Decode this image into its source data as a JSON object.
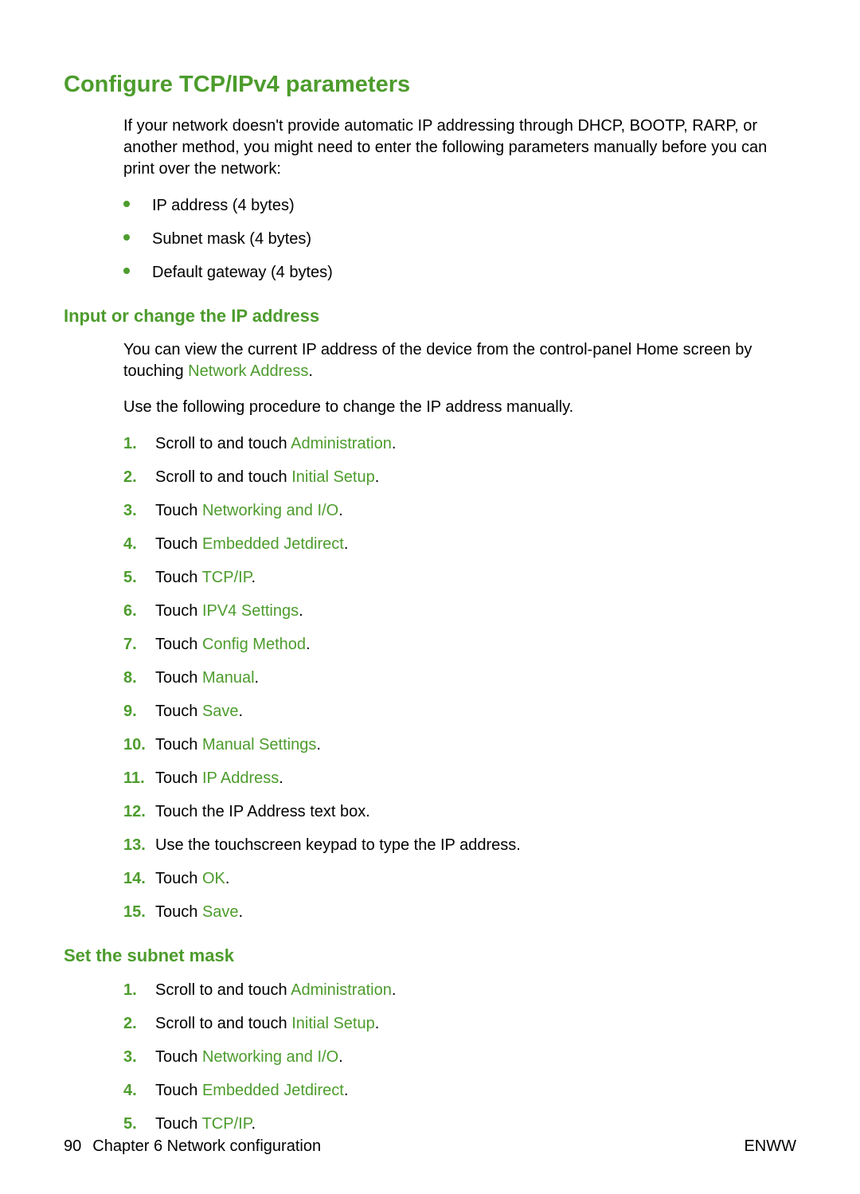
{
  "headings": {
    "h1": "Configure TCP/IPv4 parameters",
    "h2_ip": "Input or change the IP address",
    "h2_subnet": "Set the subnet mask"
  },
  "intro_para": "If your network doesn't provide automatic IP addressing through DHCP, BOOTP, RARP, or another method, you might need to enter the following parameters manually before you can print over the network:",
  "bullets": {
    "b1": "IP address (4 bytes)",
    "b2": "Subnet mask (4 bytes)",
    "b3": "Default gateway (4 bytes)"
  },
  "ip_section": {
    "para1_pre": "You can view the current IP address of the device from the control-panel Home screen by touching ",
    "para1_link": "Network Address",
    "para1_post": ".",
    "para2": "Use the following procedure to change the IP address manually."
  },
  "steps": {
    "s1_pre": "Scroll to and touch ",
    "s1_link": "Administration",
    "s1_post": ".",
    "s2_pre": "Scroll to and touch ",
    "s2_link": "Initial Setup",
    "s2_post": ".",
    "s3_pre": "Touch ",
    "s3_link": "Networking and I/O",
    "s3_post": ".",
    "s4_pre": "Touch ",
    "s4_link": "Embedded Jetdirect",
    "s4_post": ".",
    "s5_pre": "Touch ",
    "s5_link": "TCP/IP",
    "s5_post": ".",
    "s6_pre": "Touch ",
    "s6_link": "IPV4 Settings",
    "s6_post": ".",
    "s7_pre": "Touch ",
    "s7_link": "Config Method",
    "s7_post": ".",
    "s8_pre": "Touch ",
    "s8_link": "Manual",
    "s8_post": ".",
    "s9_pre": "Touch ",
    "s9_link": "Save",
    "s9_post": ".",
    "s10_pre": "Touch ",
    "s10_link": "Manual Settings",
    "s10_post": ".",
    "s11_pre": "Touch ",
    "s11_link": "IP Address",
    "s11_post": ".",
    "s12": "Touch the IP Address text box.",
    "s13": "Use the touchscreen keypad to type the IP address.",
    "s14_pre": "Touch ",
    "s14_link": "OK",
    "s14_post": ".",
    "s15_pre": "Touch ",
    "s15_link": "Save",
    "s15_post": "."
  },
  "nums": {
    "n1": "1.",
    "n2": "2.",
    "n3": "3.",
    "n4": "4.",
    "n5": "5.",
    "n6": "6.",
    "n7": "7.",
    "n8": "8.",
    "n9": "9.",
    "n10": "10.",
    "n11": "11.",
    "n12": "12.",
    "n13": "13.",
    "n14": "14.",
    "n15": "15."
  },
  "subnet_steps": {
    "s1_pre": "Scroll to and touch ",
    "s1_link": "Administration",
    "s1_post": ".",
    "s2_pre": "Scroll to and touch ",
    "s2_link": "Initial Setup",
    "s2_post": ".",
    "s3_pre": "Touch ",
    "s3_link": "Networking and I/O",
    "s3_post": ".",
    "s4_pre": "Touch ",
    "s4_link": "Embedded Jetdirect",
    "s4_post": ".",
    "s5_pre": "Touch ",
    "s5_link": "TCP/IP",
    "s5_post": "."
  },
  "footer": {
    "page_no": "90",
    "chapter": "Chapter 6   Network configuration",
    "right": "ENWW"
  }
}
